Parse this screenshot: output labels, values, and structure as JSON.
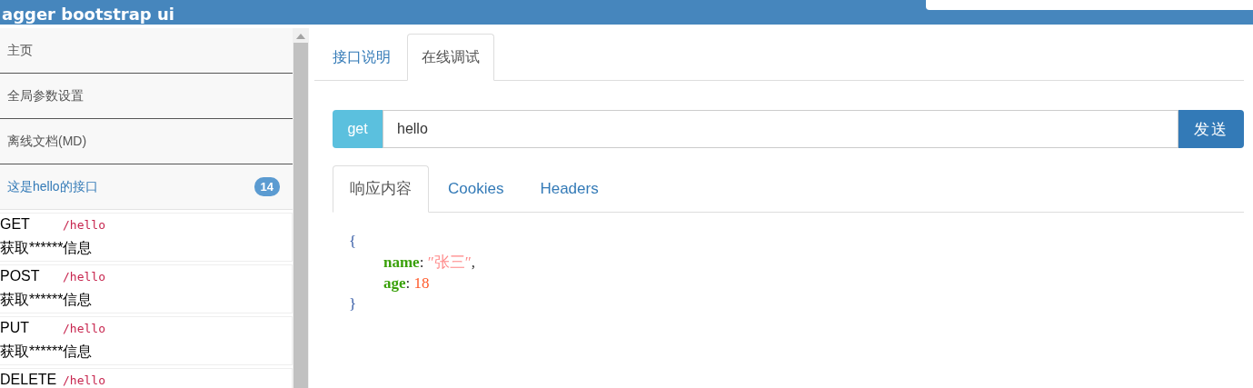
{
  "header": {
    "title": "agger bootstrap ui"
  },
  "sidebar": {
    "items": [
      {
        "label": "主页",
        "selected": false
      },
      {
        "label": "全局参数设置",
        "selected": false
      },
      {
        "label": "离线文档(MD)",
        "selected": false
      },
      {
        "label": "这是hello的接口",
        "selected": true,
        "badge": "14",
        "expanded": true,
        "children": [
          {
            "method": "GET",
            "path": "/hello",
            "summary": "获取******信息"
          },
          {
            "method": "POST",
            "path": "/hello",
            "summary": "获取******信息"
          },
          {
            "method": "PUT",
            "path": "/hello",
            "summary": "获取******信息"
          },
          {
            "method": "DELETE",
            "path": "/hello"
          }
        ]
      }
    ]
  },
  "tabs": [
    {
      "label": "接口说明",
      "selected": false
    },
    {
      "label": "在线调试",
      "selected": true
    }
  ],
  "request": {
    "method": "get",
    "url": "hello",
    "send_button": "发送"
  },
  "response_tabs": [
    {
      "label": "响应内容",
      "selected": true
    },
    {
      "label": "Cookies",
      "selected": false
    },
    {
      "label": "Headers",
      "selected": false
    }
  ],
  "response": {
    "open": "{",
    "close": "}",
    "fields": [
      {
        "key": "name",
        "colon": ":",
        "value": "″张三″",
        "kind": "string",
        "separator": ","
      },
      {
        "key": "age",
        "colon": ":",
        "value": "18",
        "kind": "number"
      }
    ]
  }
}
